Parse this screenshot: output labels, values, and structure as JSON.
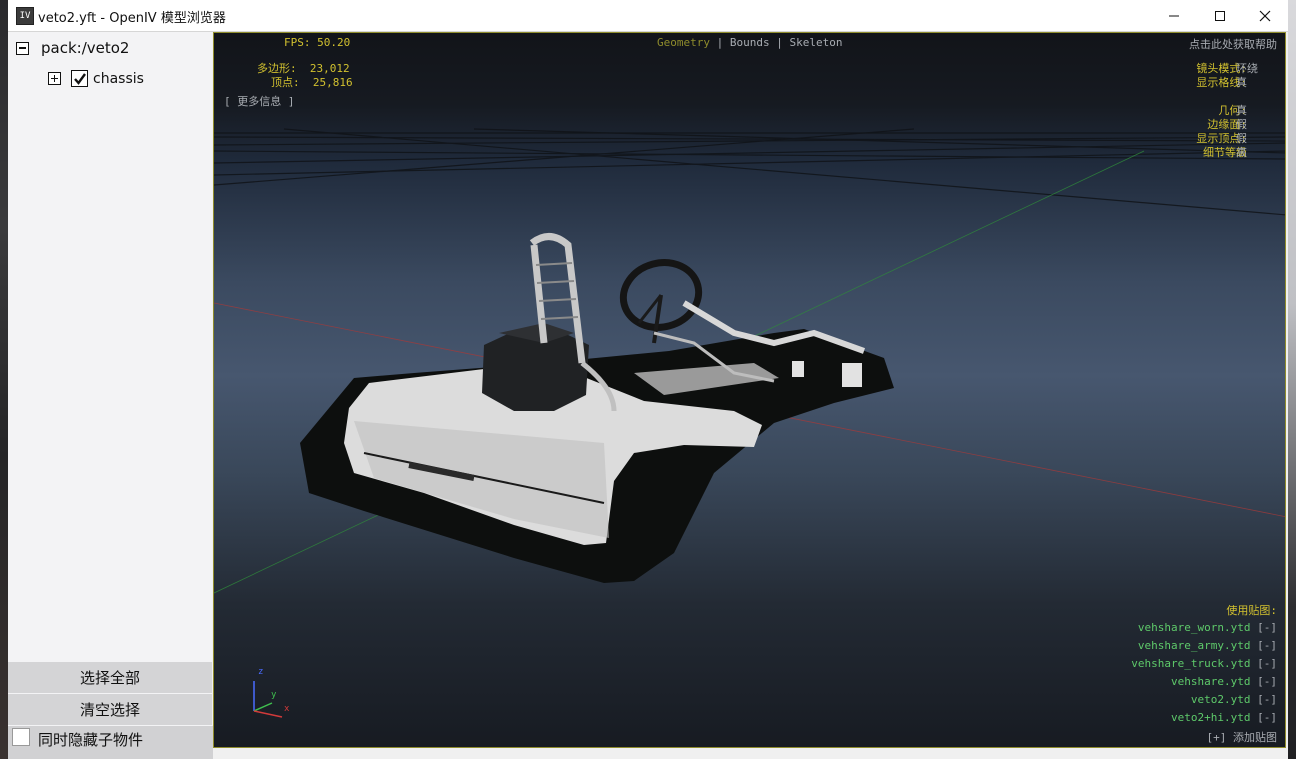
{
  "window": {
    "title": "veto2.yft - OpenIV 模型浏览器",
    "icon_text": "IV"
  },
  "tree": {
    "root_label": "pack:/veto2",
    "child_label": "chassis",
    "child_checked": true
  },
  "buttons": {
    "select_all": "选择全部",
    "clear_selection": "清空选择"
  },
  "hide_children": {
    "label": "同时隐藏子物件",
    "checked": false
  },
  "hud": {
    "fps_label": "FPS:",
    "fps_value": "50.20",
    "polygons_label": "多边形:",
    "polygons_value": "23,012",
    "vertices_label": "顶点:",
    "vertices_value": "25,816",
    "more_info": "[ 更多信息 ]",
    "tabs": [
      "Geometry",
      "Bounds",
      "Skeleton"
    ],
    "tab_sep": "|",
    "help_link": "点击此处获取帮助",
    "settings": [
      {
        "label": "镜头模式:",
        "value": "环绕"
      },
      {
        "label": "显示格线:",
        "value": "真"
      },
      {
        "label": "几何:",
        "value": "真"
      },
      {
        "label": "边缘面:",
        "value": "假"
      },
      {
        "label": "显示顶点:",
        "value": "假"
      },
      {
        "label": "细节等级",
        "value": "高"
      }
    ],
    "textures_title": "使用贴图:",
    "textures": [
      {
        "name": "vehshare_worn.ytd",
        "action": "[-]"
      },
      {
        "name": "vehshare_army.ytd",
        "action": "[-]"
      },
      {
        "name": "vehshare_truck.ytd",
        "action": "[-]"
      },
      {
        "name": "vehshare.ytd",
        "action": "[-]"
      },
      {
        "name": "veto2.ytd",
        "action": "[-]"
      },
      {
        "name": "veto2+hi.ytd",
        "action": "[-]"
      }
    ],
    "add_texture": "[+] 添加贴图",
    "axis": {
      "z": "z",
      "y": "y",
      "x": "x"
    }
  },
  "colors": {
    "hud_yellow": "#d2c12f",
    "hud_green": "#5ec96a",
    "hud_gray": "#a8acb2",
    "active_tab": "#8f8c2c"
  }
}
